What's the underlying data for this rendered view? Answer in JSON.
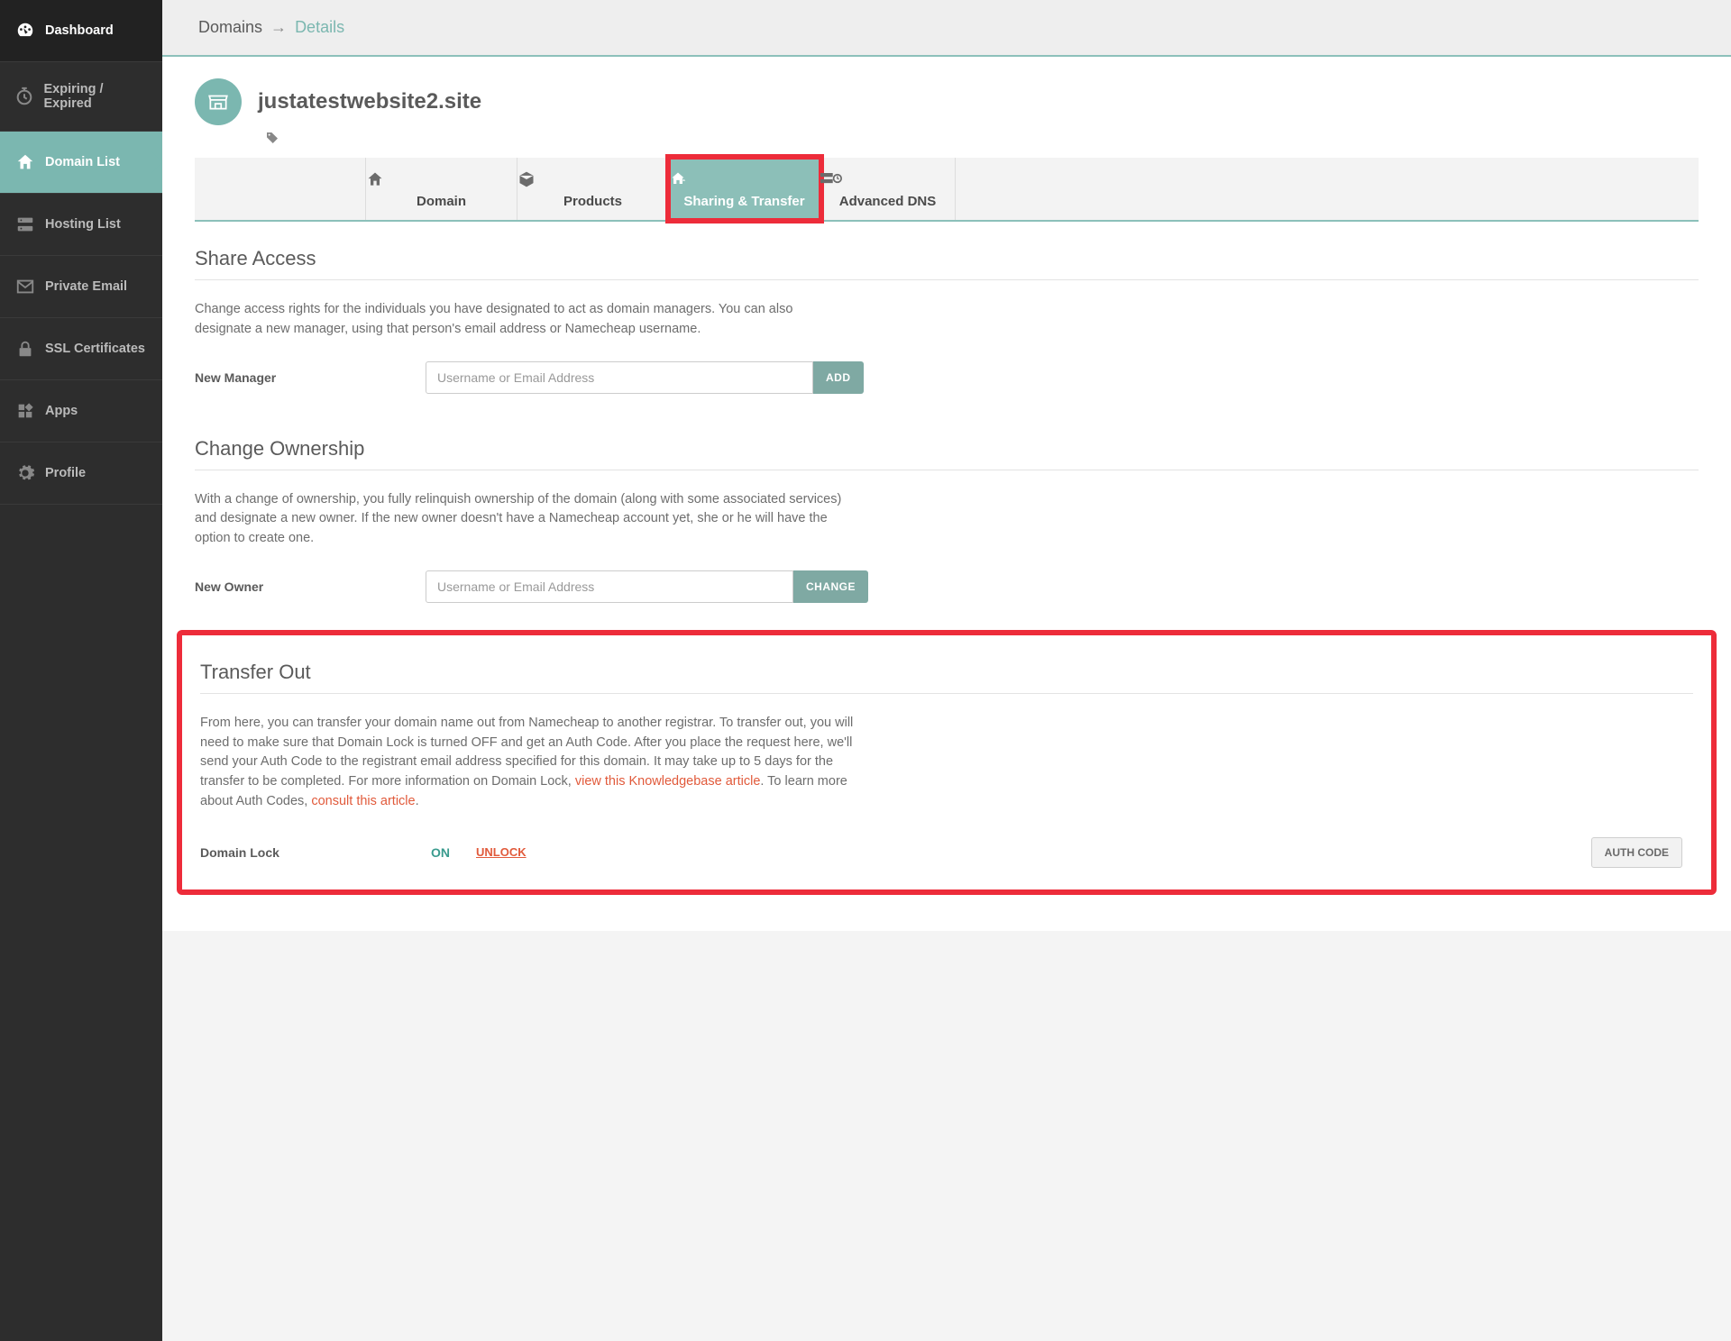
{
  "sidebar": {
    "items": [
      {
        "label": "Dashboard",
        "icon": "gauge-icon"
      },
      {
        "label": "Expiring / Expired",
        "icon": "clock-icon"
      },
      {
        "label": "Domain List",
        "icon": "home-icon"
      },
      {
        "label": "Hosting List",
        "icon": "server-icon"
      },
      {
        "label": "Private Email",
        "icon": "mail-icon"
      },
      {
        "label": "SSL Certificates",
        "icon": "lock-icon"
      },
      {
        "label": "Apps",
        "icon": "grid-icon"
      },
      {
        "label": "Profile",
        "icon": "gear-icon"
      }
    ]
  },
  "breadcrumb": {
    "root": "Domains",
    "arrow": "→",
    "current": "Details"
  },
  "domain": {
    "name": "justatestwebsite2.site"
  },
  "tabs": [
    {
      "label": "Domain"
    },
    {
      "label": "Products"
    },
    {
      "label": "Sharing & Transfer"
    },
    {
      "label": "Advanced DNS"
    }
  ],
  "share_access": {
    "title": "Share Access",
    "desc": "Change access rights for the individuals you have designated to act as domain managers. You can also designate a new manager, using that person's email address or Namecheap username.",
    "label": "New Manager",
    "placeholder": "Username or Email Address",
    "button": "ADD"
  },
  "change_ownership": {
    "title": "Change Ownership",
    "desc": "With a change of ownership, you fully relinquish ownership of the domain (along with some associated services) and designate a new owner. If the new owner doesn't have a Namecheap account yet, she or he will have the option to create one.",
    "label": "New Owner",
    "placeholder": "Username or Email Address",
    "button": "CHANGE"
  },
  "transfer_out": {
    "title": "Transfer Out",
    "desc_pre": "From here, you can transfer your domain name out from Namecheap to another registrar. To transfer out, you will need to make sure that Domain Lock is turned OFF and get an Auth Code. After you place the request here, we'll send your Auth Code to the registrant email address specified for this domain. It may take up to 5 days for the transfer to be completed. For more information on Domain Lock, ",
    "link1": "view this Knowledgebase article",
    "desc_mid": ". To learn more about Auth Codes, ",
    "link2": "consult this article",
    "desc_post": ".",
    "lock_label": "Domain Lock",
    "lock_value": "ON",
    "unlock_label": "UNLOCK",
    "auth_button": "AUTH CODE"
  }
}
